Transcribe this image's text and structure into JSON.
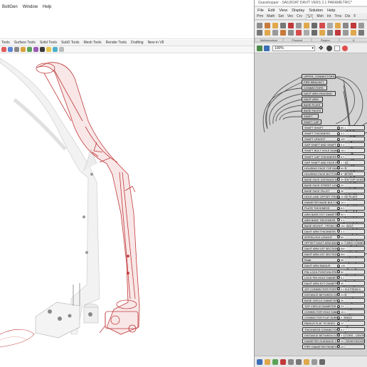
{
  "rhino": {
    "menu": [
      "BoltGen",
      "Window",
      "Help"
    ],
    "tabs": [
      "Tools",
      "Surface Tools",
      "Solid Tools",
      "SubD Tools",
      "Mesh Tools",
      "Render Tools",
      "Drafting",
      "New in V8"
    ]
  },
  "grasshopper": {
    "title": "Grasshopper - SAILBOAT DAVIT VERS 2.1 PARAMETRIC*",
    "menu": [
      "File",
      "Edit",
      "View",
      "Display",
      "Solution",
      "Help"
    ],
    "tabs": [
      "Prm",
      "Math",
      "Set",
      "Vec",
      "Crv",
      "Srf",
      "Msh",
      "Int",
      "Trns",
      "Dis",
      "F"
    ],
    "active_tab": "Srf",
    "ribbon_groups": [
      "Mathematical",
      "Physical",
      "Region",
      "U"
    ],
    "zoom": "100%",
    "groups": [
      {
        "label": "UPPER_CONNECTORS"
      },
      {
        "label": "PIPE BRACKET"
      },
      {
        "label": "CONNECTORS"
      },
      {
        "label": "DAVIT ARM HOUSING"
      },
      {
        "label": "DAVIT ARM"
      },
      {
        "label": "BASE PLATE"
      },
      {
        "label": "BASE FACES"
      },
      {
        "label": "SHAFT"
      },
      {
        "label": "SHAFT CAP"
      }
    ],
    "sliders": [
      {
        "label": "SHAFT SHAFT",
        "value": "60.1"
      },
      {
        "label": "SHAFT THICKNESS",
        "value": "3.2"
      },
      {
        "label": "SHAFT LENGHT",
        "value": "100"
      },
      {
        "label": "GAP SHAFT AND SHAFT CAP",
        "value": "0.4"
      },
      {
        "label": "SHAFT BOLT HOLE DIAMETER",
        "value": "16.0"
      },
      {
        "label": "SHAFT CAP THICKNESS",
        "value": "6.0"
      },
      {
        "label": "GAP SHAFT AND FACE HOUSING",
        "value": "1.7"
      },
      {
        "label": "HOUSING FACE TOP DIAMETER",
        "value": "65"
      },
      {
        "label": "HOUSING FACE BOTTOM DIAMETER",
        "value": "87"
      },
      {
        "label": "BASE FACE DISTANCE BETWEEN TOP CENTERS",
        "value": "39"
      },
      {
        "label": "BASE FACE STREET LENGHT",
        "value": "20"
      },
      {
        "label": "BASE FACE FILLET",
        "value": "30"
      },
      {
        "label": "HOLE-LINE OFFSET FROM EDGE PLATE",
        "value": "20"
      },
      {
        "label": "DIAMETER BASE BOLT HOLES",
        "value": "10.0"
      },
      {
        "label": "PLATE THICKNESS",
        "value": "6.0"
      },
      {
        "label": "ARM BASE EXT DIAMETER",
        "value": "50.0"
      },
      {
        "label": "ARM BASE THICKNESS",
        "value": "3.3"
      },
      {
        "label": "BASE HEIGHT - FROM CENTER BOLT",
        "value": "100"
      },
      {
        "label": "DAVIT ARM THICKNESS",
        "value": "3.3"
      },
      {
        "label": "INTERLOCK LENGHT",
        "value": "50"
      },
      {
        "label": "OFFSET DAVIT ARM AND DAVIT ARM CONNECTOR",
        "value": "30"
      },
      {
        "label": "DAVIT ARM 1ST SECTION",
        "value": "500"
      },
      {
        "label": "DAVIT ARM 1ST SECTION",
        "value": "500"
      },
      {
        "label": "Rotat",
        "value": "45"
      },
      {
        "label": "DAVIT ARM RADIUS",
        "value": "135"
      },
      {
        "label": "PIN LOCK POSITION FROM B",
        "value": "52"
      },
      {
        "label": "LOCK PIN HOLE DIAMETER",
        "value": "6.2"
      },
      {
        "label": "DAVIT ARM EXT DIAMETER",
        "value": "40"
      },
      {
        "label": "1ST CONNECTOR POSITION ON 2 FROM 0",
        "value": "0.2"
      },
      {
        "label": "DISTANCE BETWEEN CENTERS",
        "value": "23"
      },
      {
        "label": "BASE CIRCLE DIAMETER",
        "value": "30"
      },
      {
        "label": "TOP CIRCLE DIAMETER",
        "value": "23"
      },
      {
        "label": "CONNECTOR HOLE DIAMETER",
        "value": "10.0"
      },
      {
        "label": "CONNECTOR FLAT SURFACE ENDO",
        "value": "9"
      },
      {
        "label": "RADIUS FLAT TO BODY",
        "value": "12"
      },
      {
        "label": "THICKNESS CONNECTOR",
        "value": "6.0"
      },
      {
        "label": "DISTANCE BETWEEN CONNECTORS - CENTERS",
        "value": "3"
      },
      {
        "label": "DIAMETER GUIDANCE CIRCLE REINFORCER",
        "value": "25"
      },
      {
        "label": "PIPE DIAMETER REINFORCER",
        "value": "25"
      }
    ]
  }
}
